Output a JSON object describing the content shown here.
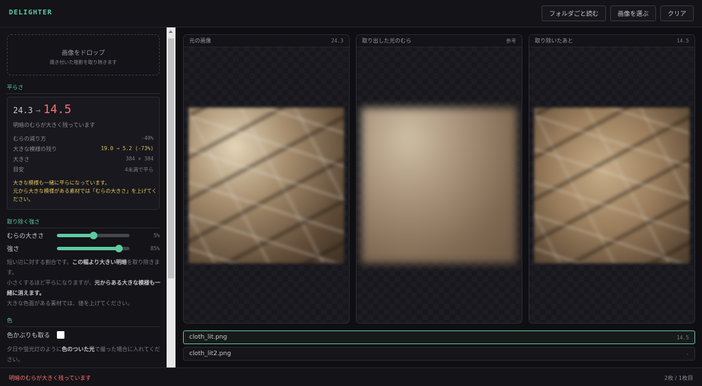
{
  "app": {
    "title": "DELIGHTER"
  },
  "header": {
    "buttons": [
      "フォルダごと読む",
      "画像を選ぶ",
      "クリア"
    ]
  },
  "dropzone": {
    "title": "画像をドロップ",
    "subtitle": "焼き付いた陰影を取り除きます"
  },
  "flatness": {
    "label": "平らさ",
    "before": "24.3",
    "after": "14.5",
    "status": "明暗のむらが大きく残っています",
    "rows": [
      {
        "label": "むらの減り方",
        "value": "-40%"
      },
      {
        "label": "大きな模様の残り",
        "value": "19.0 → 5.2 (-73%)"
      },
      {
        "label": "大きさ",
        "value": "384 × 384"
      },
      {
        "label": "目安",
        "value": "4未満で平ら"
      }
    ],
    "warning_1": "大きな模様も一緒に平らになっています。",
    "warning_2": "元から大きな模様がある素材では「むらの大きさ」を上げてください。"
  },
  "strength": {
    "label": "取り除く強さ",
    "sliders": [
      {
        "label": "むらの大きさ",
        "value": 0.5,
        "display": "5%"
      },
      {
        "label": "強さ",
        "value": 0.85,
        "display": "85%"
      }
    ],
    "help_1a": "短い辺に対する割合です。",
    "help_1b": "この幅より大きい明暗",
    "help_1c": "を取り除きます。",
    "help_2a": "小さくするほど平らになりますが、",
    "help_2b": "元からある大きな模様も一緒に消えます。",
    "help_3": "大きな色面がある素材では、値を上げてください。"
  },
  "color": {
    "label": "色",
    "checkbox_label": "色かぶりも取る",
    "help_a": "夕日や蛍光灯のように",
    "help_b": "色のついた光",
    "help_c": "で撮った場合に入れてください。"
  },
  "panels": [
    {
      "title": "元の画像",
      "value": "24.3"
    },
    {
      "title": "取り出した光のむら",
      "value": "参考"
    },
    {
      "title": "取り除いたあと",
      "value": "14.5"
    }
  ],
  "files": [
    {
      "name": "cloth_lit.png",
      "score": "14.5"
    },
    {
      "name": "cloth_lit2.png",
      "score": "-"
    }
  ],
  "footer": {
    "message": "明暗のむらが大きく残っています",
    "count": "2枚 / 1枚目"
  },
  "colors": {
    "accent": "#5fc9a0",
    "alert": "#ff6f6f",
    "warning": "#e5c35a"
  }
}
